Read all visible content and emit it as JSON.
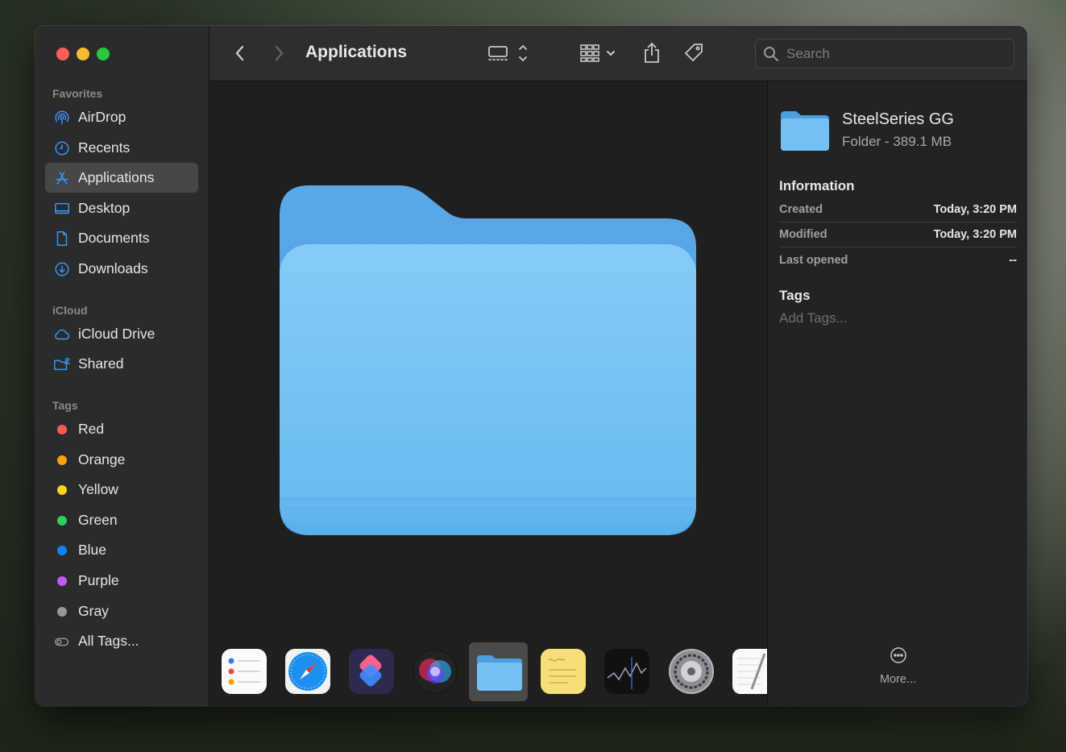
{
  "window": {
    "title": "Applications"
  },
  "sidebar": {
    "favorites_label": "Favorites",
    "favorites": [
      {
        "label": "AirDrop",
        "icon": "airdrop-icon"
      },
      {
        "label": "Recents",
        "icon": "clock-icon"
      },
      {
        "label": "Applications",
        "icon": "applications-icon",
        "active": true
      },
      {
        "label": "Desktop",
        "icon": "desktop-icon"
      },
      {
        "label": "Documents",
        "icon": "document-icon"
      },
      {
        "label": "Downloads",
        "icon": "download-icon"
      }
    ],
    "icloud_label": "iCloud",
    "icloud": [
      {
        "label": "iCloud Drive",
        "icon": "cloud-icon"
      },
      {
        "label": "Shared",
        "icon": "shared-folder-icon"
      }
    ],
    "tags_label": "Tags",
    "tags": [
      {
        "label": "Red",
        "color": "#ff5a52"
      },
      {
        "label": "Orange",
        "color": "#ff9f0a"
      },
      {
        "label": "Yellow",
        "color": "#ffd60a"
      },
      {
        "label": "Green",
        "color": "#30d158"
      },
      {
        "label": "Blue",
        "color": "#0a84ff"
      },
      {
        "label": "Purple",
        "color": "#bf5af2"
      },
      {
        "label": "Gray",
        "color": "#98989d"
      }
    ],
    "all_tags": "All Tags..."
  },
  "toolbar": {
    "search_placeholder": "Search"
  },
  "inspector": {
    "name": "SteelSeries GG",
    "subtitle": "Folder - 389.1 MB",
    "information_heading": "Information",
    "rows": [
      {
        "key": "Created",
        "value": "Today, 3:20 PM"
      },
      {
        "key": "Modified",
        "value": "Today, 3:20 PM"
      },
      {
        "key": "Last opened",
        "value": "--"
      }
    ],
    "tags_heading": "Tags",
    "add_tags": "Add Tags...",
    "more": "More..."
  },
  "dock_items": [
    "reminders-icon",
    "safari-icon",
    "shortcuts-icon",
    "siri-icon",
    "folder-icon",
    "stickies-icon",
    "stocks-icon",
    "system-settings-icon",
    "textedit-icon"
  ],
  "colors": {
    "accent": "#0a84ff",
    "folder": "#6ab8ee"
  }
}
